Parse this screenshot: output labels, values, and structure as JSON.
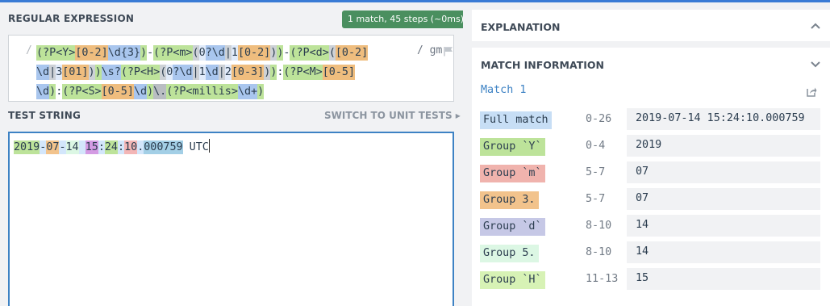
{
  "regex_section": {
    "title": "REGULAR EXPRESSION",
    "badge": "1 match, 45 steps (~0ms)",
    "delimiter_open": "/",
    "flags": "/ gm",
    "tokens": [
      {
        "text": "(?P<Y>",
        "bg": "#bde39a"
      },
      {
        "text": "[0-2]",
        "bg": "#efbd7e"
      },
      {
        "text": "\\d{3}",
        "bg": "#a9c6ee"
      },
      {
        "text": ")",
        "bg": "#bde39a"
      },
      {
        "text": "-",
        "bg": ""
      },
      {
        "text": "(?P<m>",
        "bg": "#bde39a"
      },
      {
        "text": "(",
        "bg": "#cdd1d6"
      },
      {
        "text": "0",
        "bg": "#e1ebfa"
      },
      {
        "text": "?",
        "bg": "#a9c6ee"
      },
      {
        "text": "\\d",
        "bg": "#a9c6ee"
      },
      {
        "text": "|",
        "bg": "#cdd1d6"
      },
      {
        "text": "1",
        "bg": "#e1ebfa"
      },
      {
        "text": "[0-2]",
        "bg": "#efbd7e"
      },
      {
        "text": ")",
        "bg": "#cdd1d6"
      },
      {
        "text": ")",
        "bg": "#bde39a"
      },
      {
        "text": "-",
        "bg": ""
      },
      {
        "text": "(?P<d>",
        "bg": "#bde39a"
      },
      {
        "text": "(",
        "bg": "#cdd1d6"
      },
      {
        "text": "[0-2]",
        "bg": "#efbd7e"
      },
      {
        "text": "\\d",
        "bg": "#a9c6ee"
      },
      {
        "text": "|",
        "bg": "#cdd1d6"
      },
      {
        "text": "3",
        "bg": "#e1ebfa"
      },
      {
        "text": "[01]",
        "bg": "#efbd7e"
      },
      {
        "text": ")",
        "bg": "#cdd1d6"
      },
      {
        "text": ")",
        "bg": "#bde39a"
      },
      {
        "text": "\\s?",
        "bg": "#a9c6ee"
      },
      {
        "text": "(?P<H>",
        "bg": "#bde39a"
      },
      {
        "text": "(",
        "bg": "#cdd1d6"
      },
      {
        "text": "0",
        "bg": "#e1ebfa"
      },
      {
        "text": "?",
        "bg": "#a9c6ee"
      },
      {
        "text": "\\d",
        "bg": "#a9c6ee"
      },
      {
        "text": "|",
        "bg": "#cdd1d6"
      },
      {
        "text": "1",
        "bg": "#e1ebfa"
      },
      {
        "text": "\\d",
        "bg": "#a9c6ee"
      },
      {
        "text": "|",
        "bg": "#cdd1d6"
      },
      {
        "text": "2",
        "bg": "#e1ebfa"
      },
      {
        "text": "[0-3]",
        "bg": "#efbd7e"
      },
      {
        "text": ")",
        "bg": "#cdd1d6"
      },
      {
        "text": ")",
        "bg": "#bde39a"
      },
      {
        "text": ":",
        "bg": ""
      },
      {
        "text": "(?P<M>",
        "bg": "#bde39a"
      },
      {
        "text": "[0-5]",
        "bg": "#efbd7e"
      },
      {
        "text": "\\d",
        "bg": "#a9c6ee"
      },
      {
        "text": ")",
        "bg": "#bde39a"
      },
      {
        "text": ":",
        "bg": ""
      },
      {
        "text": "(?P<S>",
        "bg": "#bde39a"
      },
      {
        "text": "[0-5]",
        "bg": "#efbd7e"
      },
      {
        "text": "\\d",
        "bg": "#a9c6ee"
      },
      {
        "text": ")",
        "bg": "#bde39a"
      },
      {
        "text": "\\.",
        "bg": "#b9bdc2"
      },
      {
        "text": "(?P<millis>",
        "bg": "#bde39a"
      },
      {
        "text": "\\d+",
        "bg": "#a9c6ee"
      },
      {
        "text": ")",
        "bg": "#bde39a"
      }
    ]
  },
  "test_section": {
    "title": "TEST STRING",
    "switch_link": "SWITCH TO UNIT TESTS ▸",
    "segments": [
      {
        "text": "2019",
        "bg": "#bde39a"
      },
      {
        "text": "-",
        "bg": "#d3e6fb"
      },
      {
        "text": "07",
        "bg": "#f2c38c"
      },
      {
        "text": "-",
        "bg": "#d3e6fb"
      },
      {
        "text": "14",
        "bg": "#dcf7e4"
      },
      {
        "text": " ",
        "bg": "#d3e6fb"
      },
      {
        "text": "15",
        "bg": "#d49be3"
      },
      {
        "text": ":",
        "bg": "#d3e6fb"
      },
      {
        "text": "24",
        "bg": "#bde39a"
      },
      {
        "text": ":",
        "bg": "#d3e6fb"
      },
      {
        "text": "10",
        "bg": "#f3b6b6"
      },
      {
        "text": ".",
        "bg": "#d3e6fb"
      },
      {
        "text": "000759",
        "bg": "#a3cfe6"
      },
      {
        "text": " UTC",
        "bg": ""
      }
    ]
  },
  "explanation": {
    "title": "EXPLANATION"
  },
  "match_info": {
    "title": "MATCH INFORMATION",
    "match_label": "Match 1",
    "rows": [
      {
        "name": "Full match",
        "range": "0-26",
        "value": "2019-07-14 15:24:10.000759",
        "color": "#c7def5"
      },
      {
        "name": "Group `Y`",
        "range": "0-4",
        "value": "2019",
        "color": "#bde39a"
      },
      {
        "name": "Group `m`",
        "range": "5-7",
        "value": "07",
        "color": "#f0b3ad"
      },
      {
        "name": "Group 3.",
        "range": "5-7",
        "value": "07",
        "color": "#f2c38c"
      },
      {
        "name": "Group `d`",
        "range": "8-10",
        "value": "14",
        "color": "#c6c8e6"
      },
      {
        "name": "Group 5.",
        "range": "8-10",
        "value": "14",
        "color": "#dcf7e4"
      },
      {
        "name": "Group `H`",
        "range": "11-13",
        "value": "15",
        "color": "#d7f2b5"
      }
    ]
  },
  "icons": [
    "flag-icon",
    "chevron-up-icon",
    "chevron-down-icon",
    "share-icon"
  ]
}
